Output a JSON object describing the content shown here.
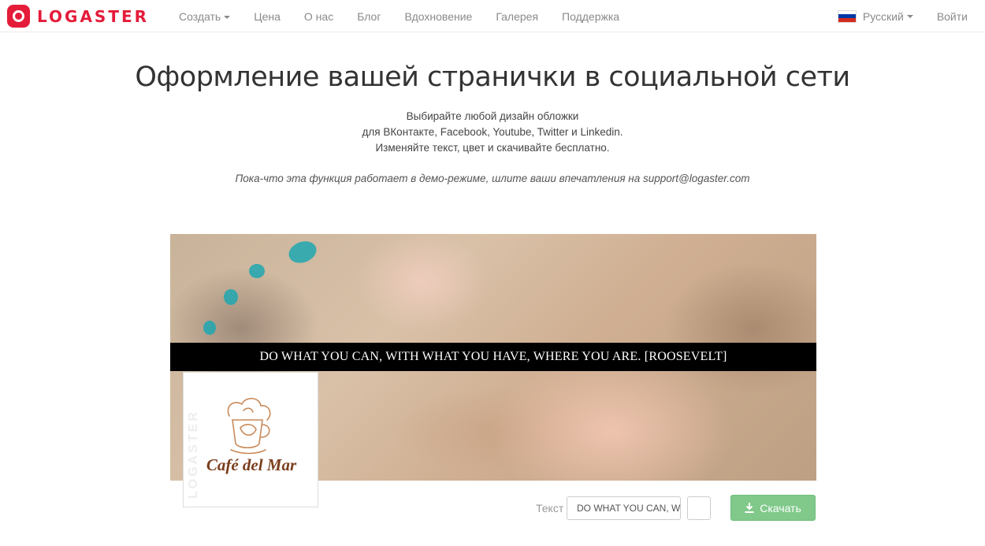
{
  "brand": {
    "name": "LOGASTER",
    "color": "#e41c3a"
  },
  "nav": {
    "items": [
      {
        "label": "Создать",
        "dropdown": true
      },
      {
        "label": "Цена"
      },
      {
        "label": "О нас"
      },
      {
        "label": "Блог"
      },
      {
        "label": "Вдохновение"
      },
      {
        "label": "Галерея"
      },
      {
        "label": "Поддержка"
      }
    ],
    "language": "Русский",
    "login": "Войти"
  },
  "page": {
    "title": "Оформление вашей странички в социальной сети",
    "subtitle_lines": [
      "Выбирайте любой дизайн обложки",
      "для ВКонтакте, Facebook, Youtube, Twitter и Linkedin.",
      "Изменяйте текст, цвет и скачивайте бесплатно."
    ],
    "note": "Пока-что эта функция работает в демо-режиме, шлите ваши впечатления на support@logaster.com"
  },
  "cover": {
    "banner_text": "DO WHAT YOU CAN, WITH WHAT YOU HAVE, WHERE YOU ARE. [ROOSEVELT]"
  },
  "avatar": {
    "brand_text": "Café del Mar",
    "watermark": "LOGASTER",
    "brand_color": "#7a3e1c"
  },
  "controls": {
    "text_label": "Текст",
    "text_value": "DO WHAT YOU CAN, WITH WHAT YOU HAVE, WHERE YOU ARE. [ROOSEVELT]",
    "download_label": "Скачать",
    "download_color": "#80c98a"
  }
}
